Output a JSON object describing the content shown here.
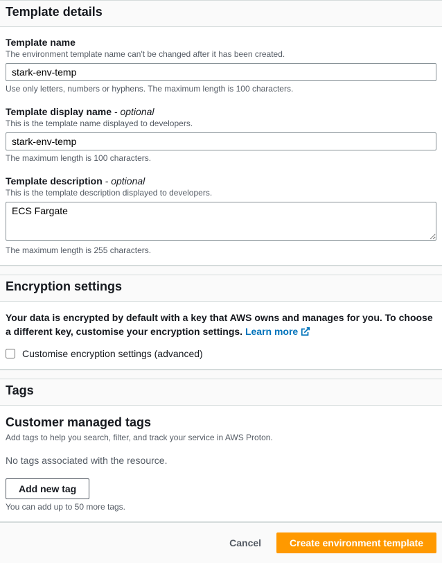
{
  "template_details": {
    "heading": "Template details",
    "name": {
      "label": "Template name",
      "desc": "The environment template name can't be changed after it has been created.",
      "value": "stark-env-temp",
      "hint": "Use only letters, numbers or hyphens. The maximum length is 100 characters."
    },
    "display_name": {
      "label": "Template display name",
      "optional": "- optional",
      "desc": "This is the template name displayed to developers.",
      "value": "stark-env-temp",
      "hint": "The maximum length is 100 characters."
    },
    "description": {
      "label": "Template description",
      "optional": "- optional",
      "desc": "This is the template description displayed to developers.",
      "value": "ECS Fargate",
      "hint": "The maximum length is 255 characters."
    }
  },
  "encryption": {
    "heading": "Encryption settings",
    "info": "Your data is encrypted by default with a key that AWS owns and manages for you. To choose a different key, customise your encryption settings.",
    "learn_more": "Learn more",
    "checkbox_label": "Customise encryption settings (advanced)"
  },
  "tags": {
    "heading": "Tags",
    "sub_heading": "Customer managed tags",
    "sub_desc": "Add tags to help you search, filter, and track your service in AWS Proton.",
    "empty": "No tags associated with the resource.",
    "add_button": "Add new tag",
    "limit": "You can add up to 50 more tags."
  },
  "footer": {
    "cancel": "Cancel",
    "submit": "Create environment template"
  }
}
